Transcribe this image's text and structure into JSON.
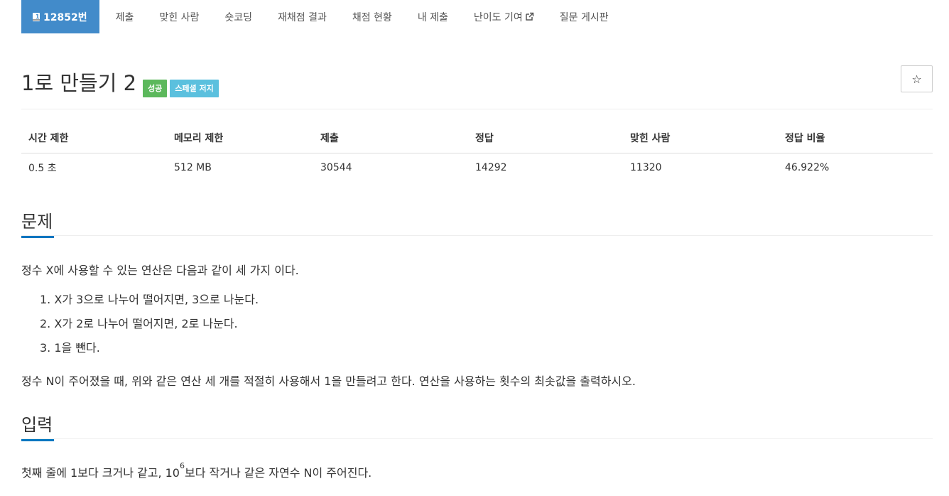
{
  "nav": {
    "problem_id": "12852번",
    "items": [
      "제출",
      "맞힌 사람",
      "숏코딩",
      "재채점 결과",
      "채점 현황",
      "내 제출",
      "난이도 기여",
      "질문 게시판"
    ]
  },
  "problem": {
    "title": "1로 만들기 2",
    "badges": [
      "성공",
      "스페셜 저지"
    ],
    "star_icon": "☆"
  },
  "info_table": {
    "headers": [
      "시간 제한",
      "메모리 제한",
      "제출",
      "정답",
      "맞힌 사람",
      "정답 비율"
    ],
    "values": [
      "0.5 초",
      "512 MB",
      "30544",
      "14292",
      "11320",
      "46.922%"
    ]
  },
  "sections": {
    "problem": {
      "heading": "문제",
      "intro": "정수 X에 사용할 수 있는 연산은 다음과 같이 세 가지 이다.",
      "steps": [
        "1. X가 3으로 나누어 떨어지면, 3으로 나눈다.",
        "2. X가 2로 나누어 떨어지면, 2로 나눈다.",
        "3. 1을 뺀다."
      ],
      "outro": "정수 N이 주어졌을 때, 위와 같은 연산 세 개를 적절히 사용해서 1을 만들려고 한다. 연산을 사용하는 횟수의 최솟값을 출력하시오."
    },
    "input": {
      "heading": "입력",
      "text_before": "첫째 줄에 1보다 크거나 같고, 10",
      "sup": "6",
      "text_after": "보다 작거나 같은 자연수 N이 주어진다."
    }
  },
  "colors": {
    "nav_active": "#428bca",
    "badge_success": "#5cb85c",
    "badge_special": "#5bc0de",
    "section_underline": "#0076c0"
  }
}
